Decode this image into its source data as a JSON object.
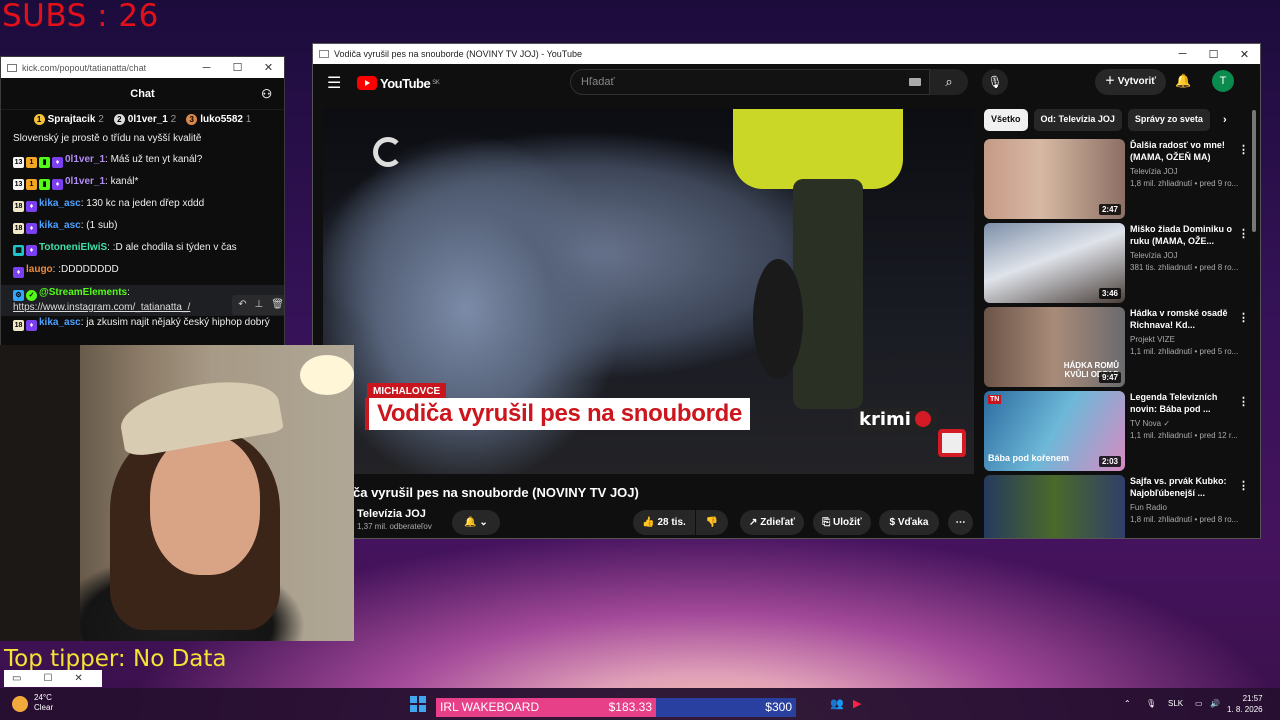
{
  "overlay": {
    "subs": "SUBS : 26",
    "top_tipper": "Top tipper: No Data"
  },
  "chat": {
    "url": "kick.com/popout/tatianatta/chat",
    "title": "Chat",
    "top_gifters": [
      {
        "name": "Sprajtacik",
        "count": "2"
      },
      {
        "name": "0l1ver_1",
        "count": "2"
      },
      {
        "name": "luko5582",
        "count": "1"
      }
    ],
    "messages": [
      {
        "user": "",
        "text": "Slovenský je prostě o třídu na vyšší kvalitě"
      },
      {
        "user": "0l1ver_1",
        "text": ": Máš už ten yt kanál?"
      },
      {
        "user": "0l1ver_1",
        "text": ": kanál*"
      },
      {
        "user": "kika_asc",
        "text": ": 130 kc na jeden dřep xddd"
      },
      {
        "user": "kika_asc",
        "text": ": (1 sub)"
      },
      {
        "user": "TotoneniElwiS",
        "text": ": :D ale chodila si týden v čas"
      },
      {
        "user": "laugo",
        "text": ": :DDDDDDDD"
      },
      {
        "user": "@StreamElements",
        "text": ":",
        "link": "https://www.instagram.com/_tatianatta_/"
      },
      {
        "user": "kika_asc",
        "text": ": ja zkusim najit nějaký český hiphop dobrý"
      }
    ]
  },
  "youtube": {
    "window_title": "Vodiča vyrušil pes na snouborde (NOVINY TV JOJ) - YouTube",
    "logo": "YouTube",
    "region": "SK",
    "search_placeholder": "Hľadať",
    "create_label": "Vytvoriť",
    "avatar_letter": "T",
    "overlay_location": "MICHALOVCE",
    "overlay_headline": "Vodiča vyrušil pes na snouborde",
    "overlay_krimi": "krimi",
    "video_title": "ča vyrušil pes na snouborde (NOVINY TV JOJ)",
    "channel": "Televízia JOJ",
    "subscribers": "1,37 mil. odberateľov",
    "likes": "28 tis.",
    "share": "Zdieľať",
    "save": "Uložiť",
    "thanks": "Vďaka",
    "chips": [
      "Všetko",
      "Od: Televízia JOJ",
      "Správy zo sveta"
    ],
    "related": [
      {
        "title": "Ďalšia radosť vo mne! (MAMA, OŽEŇ MA)",
        "channel": "Televízia JOJ",
        "meta": "1,8 mil. zhliadnutí • pred 9 ro...",
        "duration": "2:47"
      },
      {
        "title": "Miško žiada Dominiku o ruku (MAMA, OŽE...",
        "channel": "Televízia JOJ",
        "meta": "381 tis. zhliadnutí • pred 8 ro...",
        "duration": "3:46"
      },
      {
        "title": "Hádka v romské osadě Richnava! Kd...",
        "channel": "Projekt VIZE",
        "meta": "1,1 mil. zhliadnutí • pred 5 ro...",
        "duration": "9:47",
        "thumb_text": "HÁDKA ROMŮ KVŮLI ODPAD"
      },
      {
        "title": "Legenda Televizních novin: Bába pod ...",
        "channel": "TV Nova",
        "meta": "1,1 mil. zhliadnutí • pred 12 r...",
        "duration": "2:03",
        "thumb_text": "Bába pod kořenem"
      },
      {
        "title": "Sajfa vs. prvák Kubko: Najobľúbenejší ...",
        "channel": "Fun Radio",
        "meta": "1,8 mil. zhliadnutí • pred 8 ro...",
        "duration": ""
      }
    ]
  },
  "taskbar": {
    "temp": "24°C",
    "weather": "Clear",
    "ticker_label": "IRL WAKEBOARD",
    "ticker_current": "$183.33",
    "ticker_goal": "$300",
    "lang": "SLK",
    "time": "21:57",
    "date": "1. 8. 2026"
  }
}
